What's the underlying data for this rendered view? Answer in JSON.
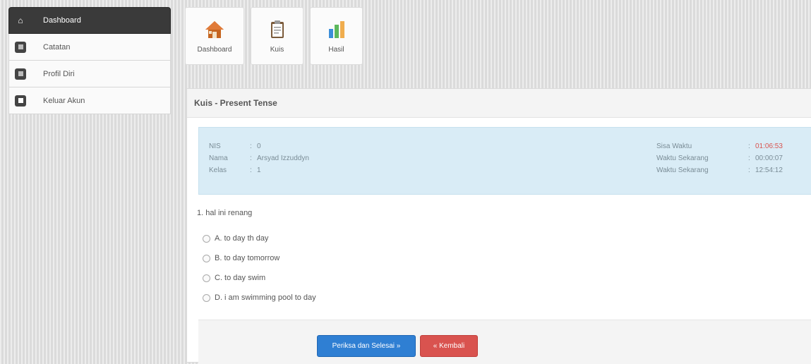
{
  "sidebar": {
    "items": [
      {
        "label": "Dashboard",
        "icon": "home-icon",
        "active": true
      },
      {
        "label": "Catatan",
        "icon": "note-icon",
        "active": false
      },
      {
        "label": "Profil Diri",
        "icon": "profile-icon",
        "active": false
      },
      {
        "label": "Keluar Akun",
        "icon": "logout-icon",
        "active": false
      }
    ]
  },
  "shortcuts": [
    {
      "label": "Dashboard",
      "icon": "house-icon"
    },
    {
      "label": "Kuis",
      "icon": "clipboard-icon"
    },
    {
      "label": "Hasil",
      "icon": "bar-chart-icon"
    }
  ],
  "panel": {
    "title": "Kuis - Present Tense"
  },
  "info": {
    "nis_label": "NIS",
    "nis_value": "0",
    "nama_label": "Nama",
    "nama_value": "Arsyad Izzuddyn",
    "kelas_label": "Kelas",
    "kelas_value": "1",
    "sisa_label": "Sisa Waktu",
    "sisa_value": "01:06:53",
    "sekarang_label": "Waktu Sekarang",
    "sekarang_value": "00:00:07",
    "waktu_label": "Waktu Sekarang",
    "waktu_value": "12:54:12"
  },
  "question": {
    "number": "1.",
    "text": "hal ini renang",
    "options": [
      "A. to day th day",
      "B. to day tomorrow",
      "C. to day swim",
      "D. i am swimming pool to day"
    ]
  },
  "buttons": {
    "submit": "Periksa dan Selesai »",
    "back": "« Kembali"
  },
  "colors": {
    "info_bg": "#d9ecf6",
    "primary": "#2f7fd3",
    "danger": "#d9534f"
  }
}
